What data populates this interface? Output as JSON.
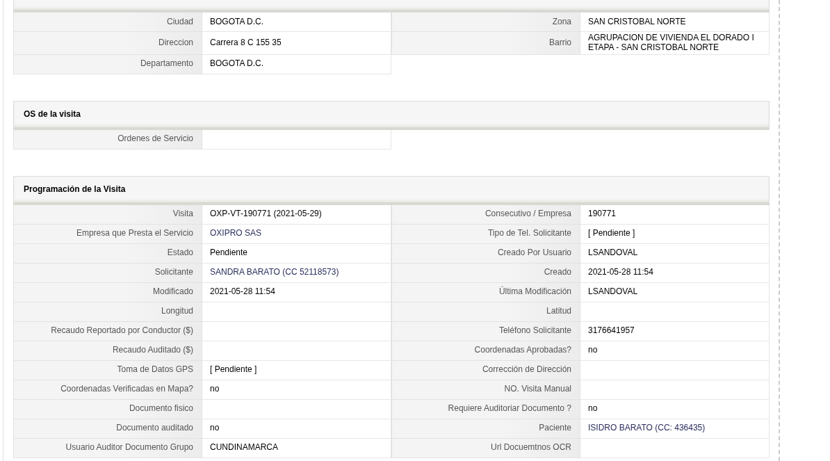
{
  "sections": [
    {
      "rows": [
        [
          {
            "label": "Ciudad",
            "value": "BOGOTA D.C."
          },
          {
            "label": "Zona",
            "value": "SAN CRISTOBAL NORTE"
          }
        ],
        [
          {
            "label": "Direccion",
            "value": "Carrera 8 C 155 35"
          },
          {
            "label": "Barrio",
            "value": "AGRUPACION DE VIVIENDA EL DORADO I ETAPA - SAN CRISTOBAL NORTE"
          }
        ],
        [
          {
            "label": "Departamento",
            "value": "BOGOTA D.C."
          }
        ]
      ]
    },
    {
      "title": "OS de la visita",
      "rows": [
        [
          {
            "label": "Ordenes de Servicio"
          }
        ]
      ]
    },
    {
      "title": "Programación de la Visita",
      "rows": [
        [
          {
            "label": "Visita",
            "value": "OXP-VT-190771 (2021-05-29)"
          },
          {
            "label": "Consecutivo / Empresa",
            "value": "190771"
          }
        ],
        [
          {
            "label": "Empresa que Presta el Servicio",
            "value": "OXIPRO SAS",
            "kind": "link"
          },
          {
            "label": "Tipo de Tel. Solicitante",
            "value": "[ Pendiente ]"
          }
        ],
        [
          {
            "label": "Estado",
            "value": "Pendiente"
          },
          {
            "label": "Creado Por Usuario",
            "value": "LSANDOVAL"
          }
        ],
        [
          {
            "label": "Solicitante",
            "value": "SANDRA BARATO (CC 52118573)",
            "kind": "link"
          },
          {
            "label": "Creado",
            "value": "2021-05-28 11:54"
          }
        ],
        [
          {
            "label": "Modificado",
            "value": "2021-05-28 11:54"
          },
          {
            "label": "Última Modificación",
            "value": "LSANDOVAL"
          }
        ],
        [
          {
            "label": "Longitud"
          },
          {
            "label": "Latitud"
          }
        ],
        [
          {
            "label": "Recaudo Reportado por Conductor ($)"
          },
          {
            "label": "Teléfono Solicitante",
            "value": "3176641957"
          }
        ],
        [
          {
            "label": "Recaudo Auditado ($)"
          },
          {
            "label": "Coordenadas Aprobadas?",
            "value": "no"
          }
        ],
        [
          {
            "label": "Toma de Datos GPS",
            "value": "[ Pendiente ]"
          },
          {
            "label": "Corrección de Dirección"
          }
        ],
        [
          {
            "label": "Coordenadas Verificadas en Mapa?",
            "value": "no"
          },
          {
            "label": "NO. Visita Manual"
          }
        ],
        [
          {
            "label": "Documento fisico"
          },
          {
            "label": "Requiere Auditoriar Documento ?",
            "value": "no"
          }
        ],
        [
          {
            "label": "Documento auditado",
            "value": "no"
          },
          {
            "label": "Paciente",
            "value": "ISIDRO BARATO (CC: 436435)",
            "kind": "link"
          }
        ],
        [
          {
            "label": "Usuario Auditor Documento Grupo",
            "value": "CUNDINAMARCA"
          },
          {
            "label": "Url Docuemtnos OCR"
          }
        ]
      ]
    }
  ]
}
